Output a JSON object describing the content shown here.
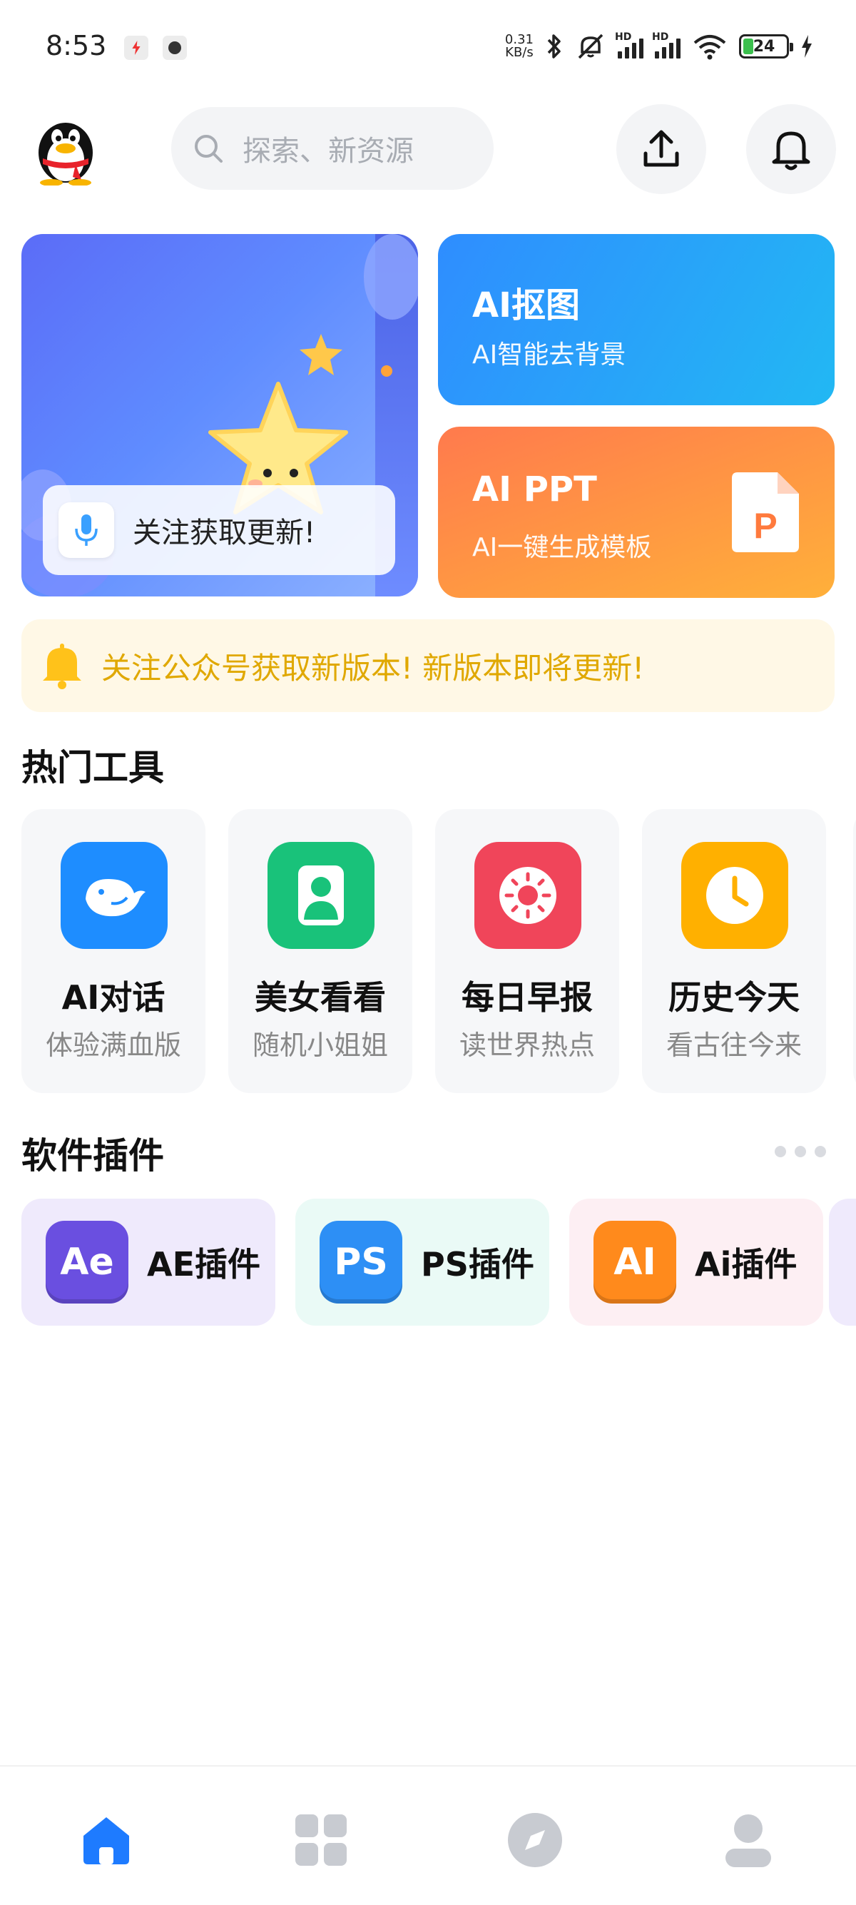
{
  "status_bar": {
    "time": "8:53",
    "speed_value": "0.31",
    "speed_unit": "KB/s",
    "battery": "24",
    "signal_1_tag": "HD",
    "signal_2_tag": "HD"
  },
  "header": {
    "search_placeholder": "探索、新资源"
  },
  "promo": {
    "follow_text": "关注获取更新!"
  },
  "cards": [
    {
      "title": "AI抠图",
      "subtitle": "AI智能去背景"
    },
    {
      "title": "AI PPT",
      "subtitle": "AI一键生成模板"
    }
  ],
  "notice": {
    "text": "关注公众号获取新版本! 新版本即将更新!"
  },
  "hot_tools": {
    "section_title": "热门工具",
    "items": [
      {
        "name": "AI对话",
        "desc": "体验满血版",
        "icon": "whale-icon",
        "color": "#1e8dff"
      },
      {
        "name": "美女看看",
        "desc": "随机小姐姐",
        "icon": "person-icon",
        "color": "#19c27a"
      },
      {
        "name": "每日早报",
        "desc": "读世界热点",
        "icon": "sun-icon",
        "color": "#f0455a"
      },
      {
        "name": "历史今天",
        "desc": "看古往今来",
        "icon": "clock-icon",
        "color": "#ffb000"
      }
    ]
  },
  "plugins": {
    "section_title": "软件插件",
    "items": [
      {
        "label": "AE插件",
        "logo_text": "Ae",
        "color": "#6a4fe0",
        "bg": "#efeafc"
      },
      {
        "label": "PS插件",
        "logo_text": "PS",
        "color": "#2d8ff5",
        "bg": "#eafaf6"
      },
      {
        "label": "Ai插件",
        "logo_text": "AI",
        "color": "#ff8a1c",
        "bg": "#fdeff3"
      }
    ]
  },
  "bottom_nav": {
    "items": [
      "home-icon",
      "apps-grid-icon",
      "compass-icon",
      "profile-icon"
    ],
    "active_color": "#1e7bff",
    "inactive_color": "#c8cbd1"
  }
}
